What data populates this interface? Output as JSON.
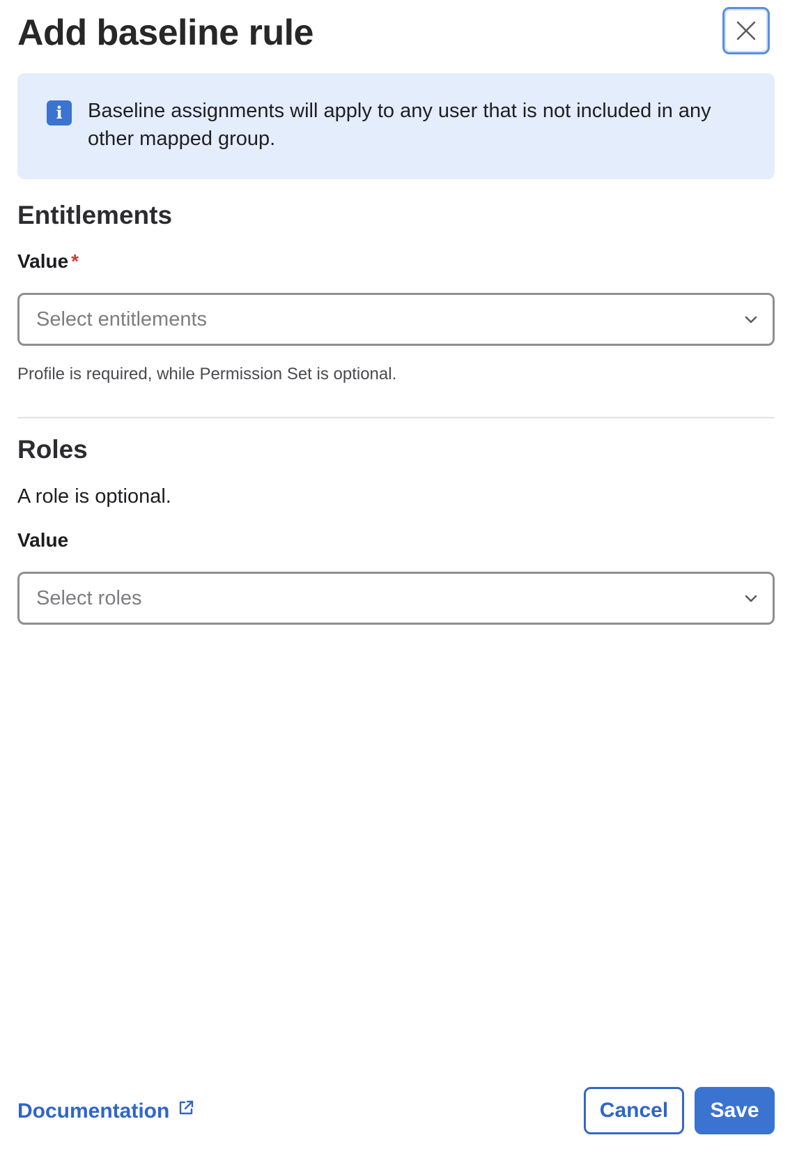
{
  "dialog": {
    "title": "Add baseline rule",
    "close_icon": "close-icon"
  },
  "banner": {
    "icon": "info-icon",
    "icon_glyph": "i",
    "text": "Baseline assignments will apply to any user that is not included in any other mapped group."
  },
  "entitlements": {
    "heading": "Entitlements",
    "label": "Value",
    "required_marker": "*",
    "placeholder": "Select entitlements",
    "help": "Profile is required, while Permission Set is optional."
  },
  "roles": {
    "heading": "Roles",
    "description": "A role is optional.",
    "label": "Value",
    "placeholder": "Select roles"
  },
  "footer": {
    "documentation_label": "Documentation",
    "external_icon": "external-link-icon",
    "cancel_label": "Cancel",
    "save_label": "Save"
  },
  "colors": {
    "accent": "#3b73d1",
    "banner_bg": "#e4edfc",
    "required": "#d23a34"
  }
}
